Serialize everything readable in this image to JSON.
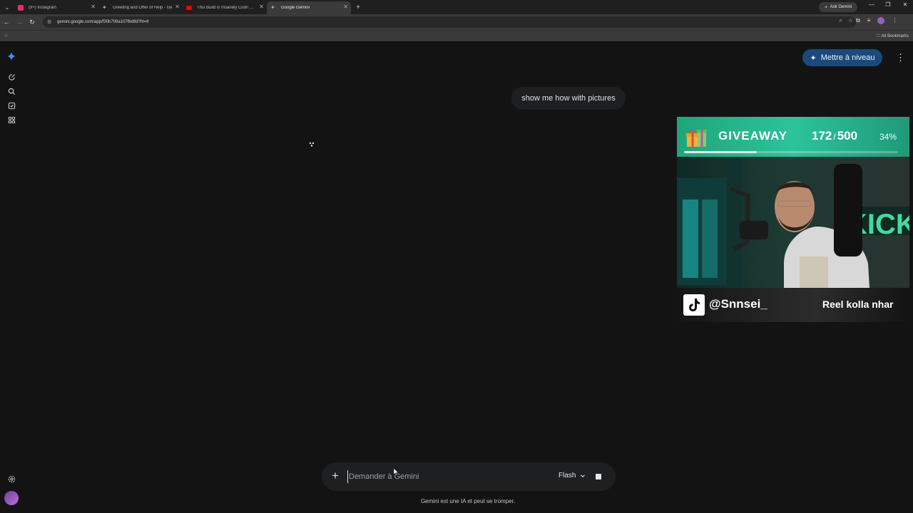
{
  "browser": {
    "tabs": [
      {
        "label": "(9+) Instagram",
        "favicon_color": "#e1306c",
        "active": false
      },
      {
        "label": "Greeting and Offer of Help - Ge",
        "favicon_color": "#8ab4f8",
        "active": false
      },
      {
        "label": "This Build is Insanely Cool! HAV",
        "favicon_color": "#ff0000",
        "active": false
      },
      {
        "label": "Google Gemini",
        "favicon_color": "#8ab4f8",
        "active": true
      }
    ],
    "ask_gemini_label": "Ask Gemini",
    "url": "gemini.google.com/app/f30b709a107fbd9d?hl=fr",
    "all_bookmarks_label": "All Bookmarks"
  },
  "gemini": {
    "upgrade_label": "Mettre à niveau",
    "user_message": "show me how with pictures",
    "input_placeholder": "Demander à Gemini",
    "model_label": "Flash",
    "disclaimer": "Gemini est une IA et peut se tromper.",
    "accent_color": "#1b4a7a"
  },
  "overlay": {
    "giveaway_title": "GIVEAWAY",
    "giveaway_current": "172",
    "giveaway_separator": "/",
    "giveaway_target": "500",
    "giveaway_percent": "34%",
    "giveaway_progress_fraction": 0.34,
    "handle": "@Snnsei_",
    "caption": "Reel kolla nhar",
    "bar_color": "#2cc39b"
  }
}
